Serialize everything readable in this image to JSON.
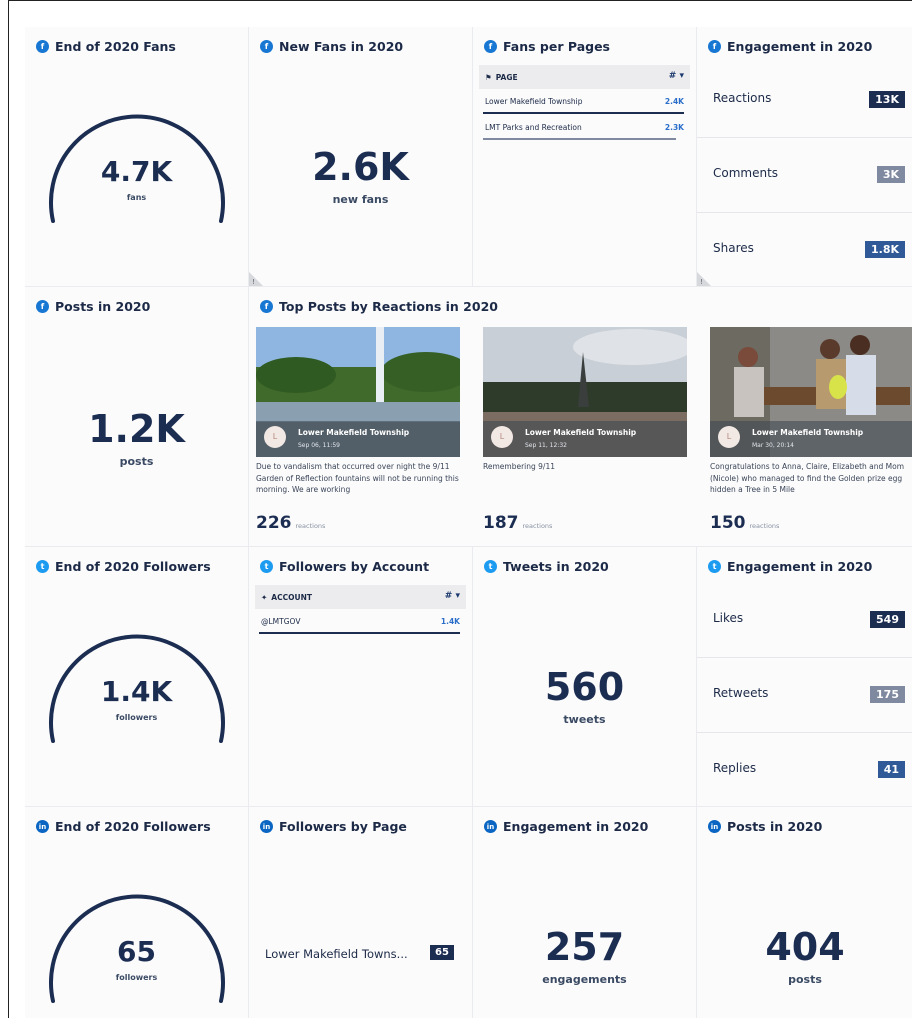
{
  "row1": {
    "fans": {
      "network": "f",
      "title": "End of 2020 Fans",
      "value": "4.7K",
      "unit": "fans",
      "gauge_fraction": 1.0
    },
    "new_fans": {
      "network": "f",
      "title": "New Fans in 2020",
      "value": "2.6K",
      "unit": "new fans"
    },
    "fans_per_page": {
      "network": "f",
      "title": "Fans per Pages",
      "column": "PAGE",
      "control": "# ▾",
      "rows": [
        {
          "name": "Lower Makefield Township",
          "value": "2.4K",
          "fraction": 1.0
        },
        {
          "name": "LMT Parks and Recreation",
          "value": "2.3K",
          "fraction": 0.96
        }
      ]
    },
    "engagement": {
      "network": "f",
      "title": "Engagement in 2020",
      "rows": [
        {
          "label": "Reactions",
          "value": "13K",
          "color": "#1c2d52"
        },
        {
          "label": "Comments",
          "value": "3K",
          "color": "#7f8aa0"
        },
        {
          "label": "Shares",
          "value": "1.8K",
          "color": "#2f5a97"
        }
      ]
    }
  },
  "row2": {
    "posts": {
      "network": "f",
      "title": "Posts in 2020",
      "value": "1.2K",
      "unit": "posts"
    },
    "top_posts": {
      "network": "f",
      "title": "Top Posts by Reactions in 2020",
      "reactions_label": "reactions",
      "posts": [
        {
          "avatar": "L",
          "page": "Lower Makefield Township",
          "date": "Sep 06, 11:59",
          "text": "Due to vandalism that occurred over night the 9/11 Garden of Reflection fountains will not be running this morning. We are working",
          "reactions": "226"
        },
        {
          "avatar": "L",
          "page": "Lower Makefield Township",
          "date": "Sep 11, 12:32",
          "text": "Remembering 9/11",
          "reactions": "187"
        },
        {
          "avatar": "L",
          "page": "Lower Makefield Township",
          "date": "Mar 30, 20:14",
          "text": "Congratulations to Anna, Claire, Elizabeth and Mom (Nicole) who managed to find the Golden prize egg hidden a Tree in 5 Mile",
          "reactions": "150"
        }
      ]
    }
  },
  "row3": {
    "followers": {
      "network": "t",
      "title": "End of 2020 Followers",
      "value": "1.4K",
      "unit": "followers",
      "gauge_fraction": 1.0
    },
    "by_account": {
      "network": "t",
      "title": "Followers by Account",
      "column": "ACCOUNT",
      "control": "# ▾",
      "rows": [
        {
          "name": "@LMTGOV",
          "value": "1.4K",
          "fraction": 1.0
        }
      ]
    },
    "tweets": {
      "network": "t",
      "title": "Tweets in 2020",
      "value": "560",
      "unit": "tweets"
    },
    "engagement": {
      "network": "t",
      "title": "Engagement in 2020",
      "rows": [
        {
          "label": "Likes",
          "value": "549",
          "color": "#1c2d52"
        },
        {
          "label": "Retweets",
          "value": "175",
          "color": "#7f8aa0"
        },
        {
          "label": "Replies",
          "value": "41",
          "color": "#2f5a97"
        }
      ]
    }
  },
  "row4": {
    "followers": {
      "network": "in",
      "title": "End of 2020 Followers",
      "value": "65",
      "unit": "followers",
      "gauge_fraction": 1.0
    },
    "by_page": {
      "network": "in",
      "title": "Followers by Page",
      "name": "Lower Makefield Towns...",
      "value": "65"
    },
    "engagement": {
      "network": "in",
      "title": "Engagement in 2020",
      "value": "257",
      "unit": "engagements"
    },
    "posts": {
      "network": "in",
      "title": "Posts in 2020",
      "value": "404",
      "unit": "posts"
    }
  }
}
